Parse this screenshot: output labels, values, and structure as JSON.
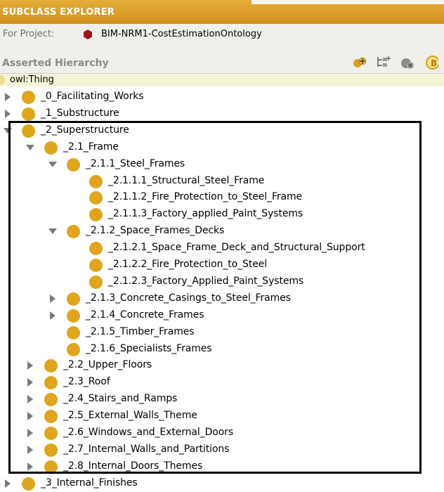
{
  "header": {
    "title": "SUBCLASS EXPLORER"
  },
  "project": {
    "label": "For Project:",
    "name": "BIM-NRM1-CostEstimationOntology"
  },
  "hierarchy": {
    "title": "Asserted Hierarchy"
  },
  "root": {
    "label": "owl:Thing"
  },
  "rows": [
    {
      "label": "_0_Facilitating_Works",
      "level": 0,
      "toggle": "collapsed"
    },
    {
      "label": "_1_Substructure",
      "level": 0,
      "toggle": "collapsed"
    },
    {
      "label": "_2_Superstructure",
      "level": 0,
      "toggle": "expanded"
    },
    {
      "label": "_2.1_Frame",
      "level": 1,
      "toggle": "expanded"
    },
    {
      "label": "_2.1.1_Steel_Frames",
      "level": 2,
      "toggle": "expanded"
    },
    {
      "label": "_2.1.1.1_Structural_Steel_Frame",
      "level": 3,
      "toggle": "none"
    },
    {
      "label": "_2.1.1.2_Fire_Protection_to_Steel_Frame",
      "level": 3,
      "toggle": "none"
    },
    {
      "label": "_2.1.1.3_Factory_applied_Paint_Systems",
      "level": 3,
      "toggle": "none"
    },
    {
      "label": "_2.1.2_Space_Frames_Decks",
      "level": 2,
      "toggle": "expanded"
    },
    {
      "label": "_2.1.2.1_Space_Frame_Deck_and_Structural_Support",
      "level": 3,
      "toggle": "none"
    },
    {
      "label": "_2.1.2.2_Fire_Protection_to_Steel",
      "level": 3,
      "toggle": "none"
    },
    {
      "label": "_2.1.2.3_Factory_Applied_Paint_Systems",
      "level": 3,
      "toggle": "none"
    },
    {
      "label": "_2.1.3_Concrete_Casings_to_Steel_Frames",
      "level": 2,
      "toggle": "collapsed"
    },
    {
      "label": "_2.1.4_Concrete_Frames",
      "level": 2,
      "toggle": "collapsed"
    },
    {
      "label": "_2.1.5_Timber_Frames",
      "level": 2,
      "toggle": "none"
    },
    {
      "label": "_2.1.6_Specialists_Frames",
      "level": 2,
      "toggle": "none"
    },
    {
      "label": "_2.2_Upper_Floors",
      "level": 1,
      "toggle": "collapsed"
    },
    {
      "label": "_2.3_Roof",
      "level": 1,
      "toggle": "collapsed"
    },
    {
      "label": "_2.4_Stairs_and_Ramps",
      "level": 1,
      "toggle": "collapsed"
    },
    {
      "label": "_2.5_External_Walls_Theme",
      "level": 1,
      "toggle": "collapsed"
    },
    {
      "label": "_2.6_Windows_and_External_Doors",
      "level": 1,
      "toggle": "collapsed"
    },
    {
      "label": "_2.7_Internal_Walls_and_Partitions",
      "level": 1,
      "toggle": "collapsed"
    },
    {
      "label": "_2.8_Internal_Doors_Themes",
      "level": 1,
      "toggle": "collapsed"
    },
    {
      "label": "_3_Internal_Finishes",
      "level": 0,
      "toggle": "collapsed"
    }
  ],
  "toolbar_icons": [
    "add-subclass-icon",
    "add-sibling-icon",
    "delete-class-icon",
    "more-icon"
  ],
  "colors": {
    "header": "#d89a25",
    "class_dot": "#dfa51f",
    "root_dot": "#f2d991",
    "project_icon": "#a0141e"
  }
}
